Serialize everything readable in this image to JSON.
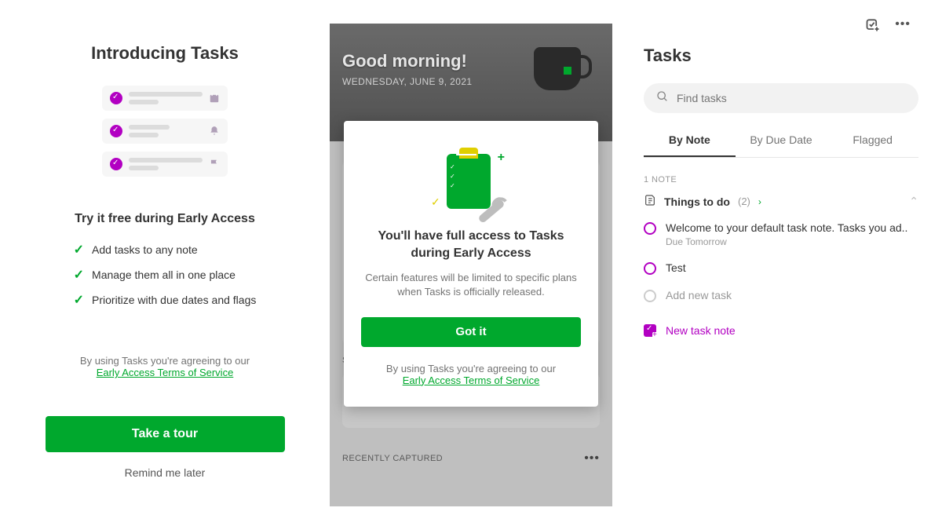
{
  "left": {
    "title": "Introducing Tasks",
    "subtitle": "Try it free during Early Access",
    "bullets": [
      "Add tasks to any note",
      "Manage them all in one place",
      "Prioritize with due dates and flags"
    ],
    "agree_prefix": "By using Tasks you're agreeing to our",
    "terms_link": "Early Access Terms of Service ",
    "cta": "Take a tour",
    "remind": "Remind me later"
  },
  "middle": {
    "greeting": "Good morning!",
    "date": "WEDNESDAY, JUNE 9, 2021",
    "section_scratch": "S",
    "section_recent": "RECENTLY CAPTURED",
    "modal": {
      "title": "You'll have full access to Tasks during Early Access",
      "body": "Certain features will be limited to specific plans when Tasks is officially released.",
      "cta": "Got it",
      "agree_prefix": "By using Tasks you're agreeing to our",
      "terms_link": "Early Access Terms of Service "
    }
  },
  "right": {
    "title": "Tasks",
    "search_placeholder": "Find tasks",
    "tabs": [
      "By Note",
      "By Due Date",
      "Flagged"
    ],
    "note_count_label": "1 NOTE",
    "note_title": "Things to do",
    "note_task_count": "(2)",
    "tasks": [
      {
        "text": "Welcome to your default task note. Tasks you ad..",
        "due": "Due Tomorrow"
      },
      {
        "text": "Test",
        "due": ""
      }
    ],
    "add_task": "Add new task",
    "new_note": "New task note"
  }
}
